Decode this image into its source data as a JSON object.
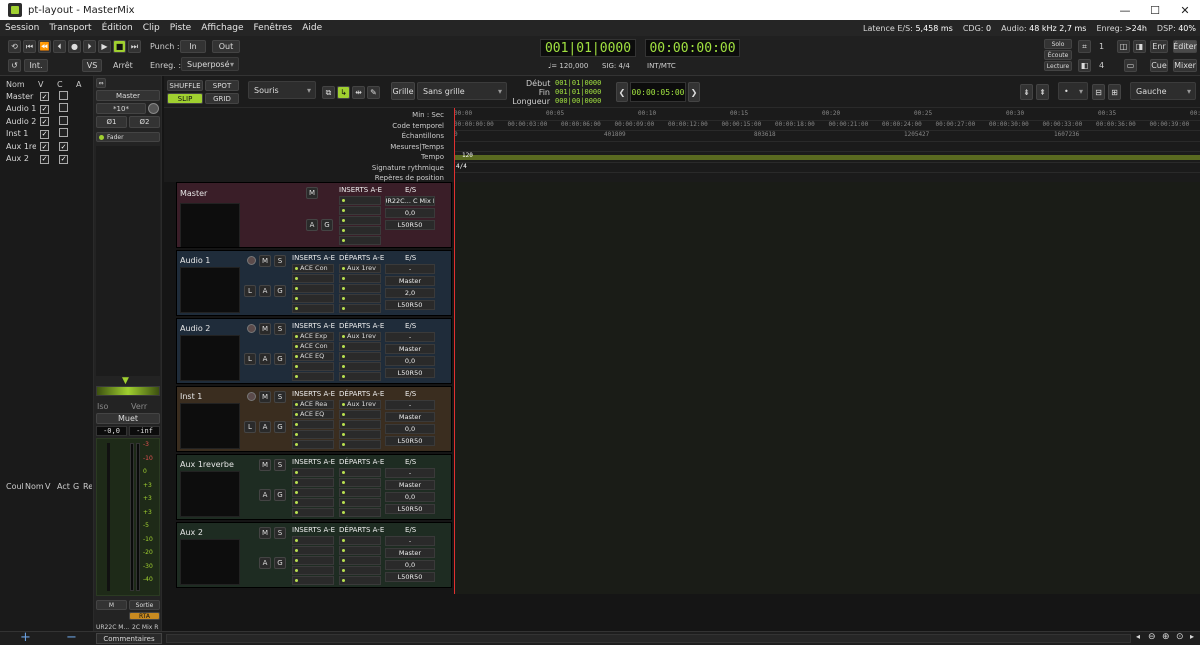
{
  "window": {
    "title": "pt-layout - MasterMix"
  },
  "menu": [
    "Session",
    "Transport",
    "Édition",
    "Clip",
    "Piste",
    "Affichage",
    "Fenêtres",
    "Aide"
  ],
  "status": {
    "latency_label": "Latence E/S:",
    "latency_value": "5,458 ms",
    "cdg_label": "CDG:",
    "cdg_value": "0",
    "audio_label": "Audio:",
    "audio_value": "48 kHz",
    "audio_ms": "2,7 ms",
    "rec_label": "Enreg:",
    "rec_value": ">24h",
    "dsp_label": "DSP:",
    "dsp_value": "40%"
  },
  "transport": {
    "punch_label": "Punch :",
    "in": "In",
    "out": "Out",
    "int": "Int.",
    "vs": "VS",
    "stop": "Arrêt",
    "rec_label": "Enreg. :",
    "rec_mode": "Superposé",
    "bbt": "001|01|0000",
    "timecode": "00:00:00:00",
    "tempo": "♩= 120,000",
    "sig": "SIG: 4/4",
    "sync": "INT/MTC"
  },
  "right_tools": {
    "solo": "Solo",
    "ecoute": "Écoute",
    "lecture": "Lecture",
    "count1": "1",
    "count2": "4",
    "enr": "Enr",
    "editer": "Éditer",
    "cue": "Cue",
    "mixer": "Mixer"
  },
  "editbar": {
    "shuffle": "SHUFFLE",
    "spot": "SPOT",
    "slip": "SLIP",
    "grid": "GRID",
    "tool": "Souris",
    "grille_label": "Grille",
    "grille_value": "Sans grille",
    "debut_label": "Début",
    "debut": "001|01|0000",
    "fin_label": "Fin",
    "fin": "001|01|0000",
    "longueur_label": "Longueur",
    "longueur": "000|00|0000",
    "nudge": "00:00:05:00",
    "snap": "•",
    "align": "Gauche"
  },
  "tracklist": {
    "headers": [
      "Nom",
      "V",
      "C",
      "A"
    ],
    "rows": [
      {
        "name": "Master",
        "v": true,
        "c": false,
        "a": false
      },
      {
        "name": "Audio 1",
        "v": true,
        "c": false,
        "a": false
      },
      {
        "name": "Audio 2",
        "v": true,
        "c": false,
        "a": false
      },
      {
        "name": "Inst 1",
        "v": true,
        "c": false,
        "a": false
      },
      {
        "name": "Aux 1rev",
        "v": true,
        "c": true,
        "a": false
      },
      {
        "name": "Aux 2",
        "v": true,
        "c": true,
        "a": false
      }
    ],
    "regions_headers": [
      "Coul",
      "Nom",
      "V",
      "Act",
      "G",
      "Re"
    ]
  },
  "mixstrip": {
    "name": "Master",
    "gain": "*10*",
    "in1": "Ø1",
    "in2": "Ø2",
    "fader": "Fader",
    "iso": "Iso",
    "verr": "Verr",
    "mute": "Muet",
    "level": "-0,0",
    "peak": "-inf",
    "m": "M",
    "sortie": "Sortie",
    "rta": "RTA",
    "out": "UR22C M...",
    "out2": "2C Mix R",
    "scale": [
      "-3",
      "-10",
      "0",
      "+3",
      "+3",
      "+3",
      "-5",
      "-10",
      "-20",
      "-30",
      "-40"
    ]
  },
  "rulers": {
    "labels": [
      "Min : Sec",
      "Code temporel",
      "Échantillons",
      "Mesures|Temps",
      "Tempo",
      "Signature rythmique",
      "Repères de position"
    ],
    "minsec": [
      "00:00",
      "00:05",
      "00:10",
      "00:15",
      "00:20",
      "00:25",
      "00:30",
      "00:35",
      "00:40"
    ],
    "timecode": [
      "00:00:00:00",
      "00:00:03:00",
      "00:00:06:00",
      "00:00:09:00",
      "00:00:12:00",
      "00:00:15:00",
      "00:00:18:00",
      "00:00:21:00",
      "00:00:24:00",
      "00:00:27:00",
      "00:00:30:00",
      "00:00:33:00",
      "00:00:36:00",
      "00:00:39:00"
    ],
    "samples": [
      "0",
      "401809",
      "803618",
      "1205427",
      "1607236"
    ],
    "tempo": "120",
    "sig": "4/4"
  },
  "tracks": [
    {
      "name": "Master",
      "bg": "#3a1e28",
      "inserts": "INSERTS A-E",
      "sends": "",
      "io": "E/S",
      "in": "UR22C...  C Mix R",
      "out": "",
      "gain": "0,0",
      "pan": "L50R50",
      "slots": [
        "",
        "",
        "",
        "",
        ""
      ],
      "send_slots": [],
      "rec": false
    },
    {
      "name": "Audio 1",
      "bg": "#1f2c3a",
      "inserts": "INSERTS A-E",
      "sends": "DÉPARTS A-E",
      "io": "E/S",
      "in": "-",
      "out": "Master",
      "gain": "2,0",
      "pan": "L50R50",
      "slots": [
        "ACE Con",
        "",
        "",
        "",
        ""
      ],
      "send_slots": [
        "Aux 1rev",
        "",
        "",
        "",
        ""
      ],
      "rec": true
    },
    {
      "name": "Audio 2",
      "bg": "#1f2c3a",
      "inserts": "INSERTS A-E",
      "sends": "DÉPARTS A-E",
      "io": "E/S",
      "in": "-",
      "out": "Master",
      "gain": "0,0",
      "pan": "L50R50",
      "slots": [
        "ACE Exp",
        "ACE Con",
        "ACE EQ",
        "",
        ""
      ],
      "send_slots": [
        "Aux 1rev",
        "",
        "",
        "",
        ""
      ],
      "rec": true
    },
    {
      "name": "Inst 1",
      "bg": "#3a2d1f",
      "inserts": "INSERTS A-E",
      "sends": "DÉPARTS A-E",
      "io": "E/S",
      "in": "-",
      "out": "Master",
      "gain": "0,0",
      "pan": "L50R50",
      "slots": [
        "ACE Rea",
        "ACE EQ",
        "",
        "",
        ""
      ],
      "send_slots": [
        "Aux 1rev",
        "",
        "",
        "",
        ""
      ],
      "rec": true
    },
    {
      "name": "Aux 1reverbe",
      "bg": "#1e2c22",
      "inserts": "INSERTS A-E",
      "sends": "DÉPARTS A-E",
      "io": "E/S",
      "in": "-",
      "out": "Master",
      "gain": "0,0",
      "pan": "L50R50",
      "slots": [
        "",
        "",
        "",
        "",
        ""
      ],
      "send_slots": [
        "",
        "",
        "",
        "",
        ""
      ],
      "rec": false
    },
    {
      "name": "Aux 2",
      "bg": "#1e2c22",
      "inserts": "INSERTS A-E",
      "sends": "DÉPARTS A-E",
      "io": "E/S",
      "in": "-",
      "out": "Master",
      "gain": "0,0",
      "pan": "L50R50",
      "slots": [
        "",
        "",
        "",
        "",
        ""
      ],
      "send_slots": [
        "",
        "",
        "",
        "",
        ""
      ],
      "rec": false
    }
  ],
  "bottom": {
    "comments": "Commentaires",
    "add": "+",
    "remove": "−"
  }
}
